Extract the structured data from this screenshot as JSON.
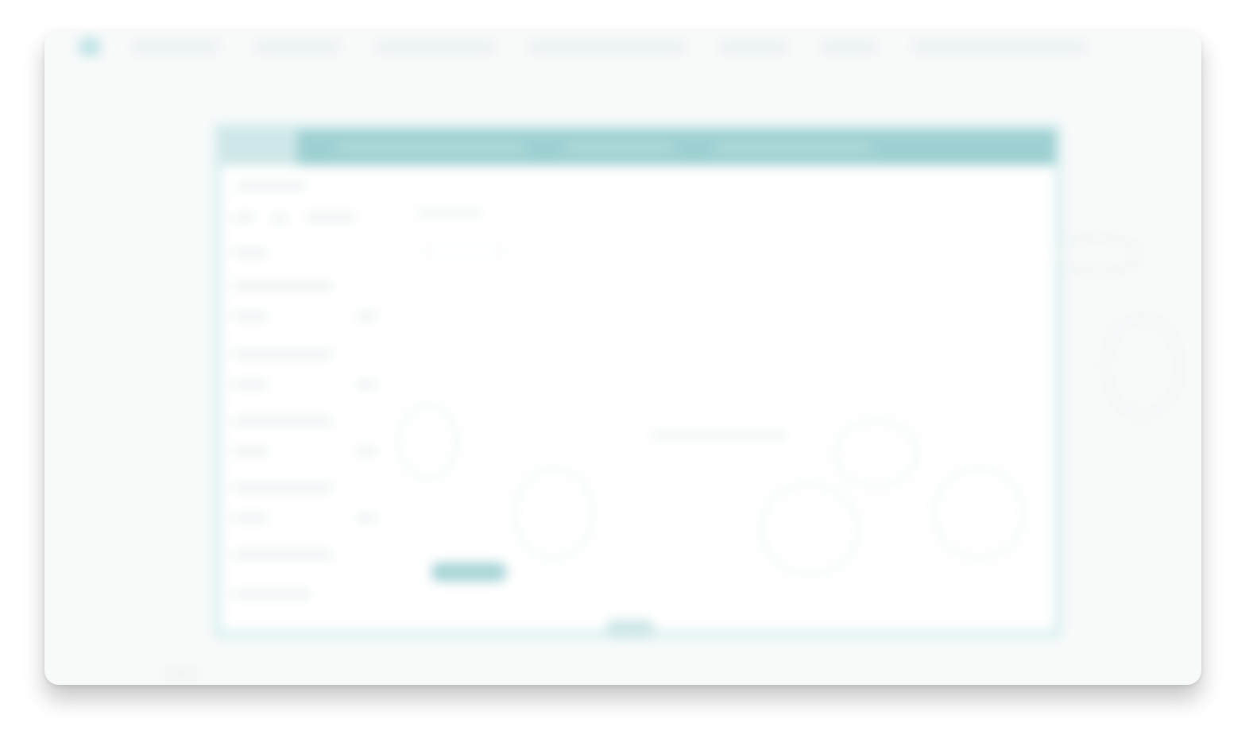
{
  "window": {
    "label": ""
  },
  "top_nav": {
    "items": [
      "",
      "",
      "",
      "",
      "",
      "",
      ""
    ]
  },
  "preview": {
    "header_title": "",
    "main_title": "",
    "center_heading": "",
    "cta_label": ""
  },
  "colors": {
    "accent": "#9ed0d2",
    "accent_light": "#d3ecee",
    "page_bg": "#f8fafa"
  },
  "icons": {
    "logo": "app-logo-icon"
  }
}
